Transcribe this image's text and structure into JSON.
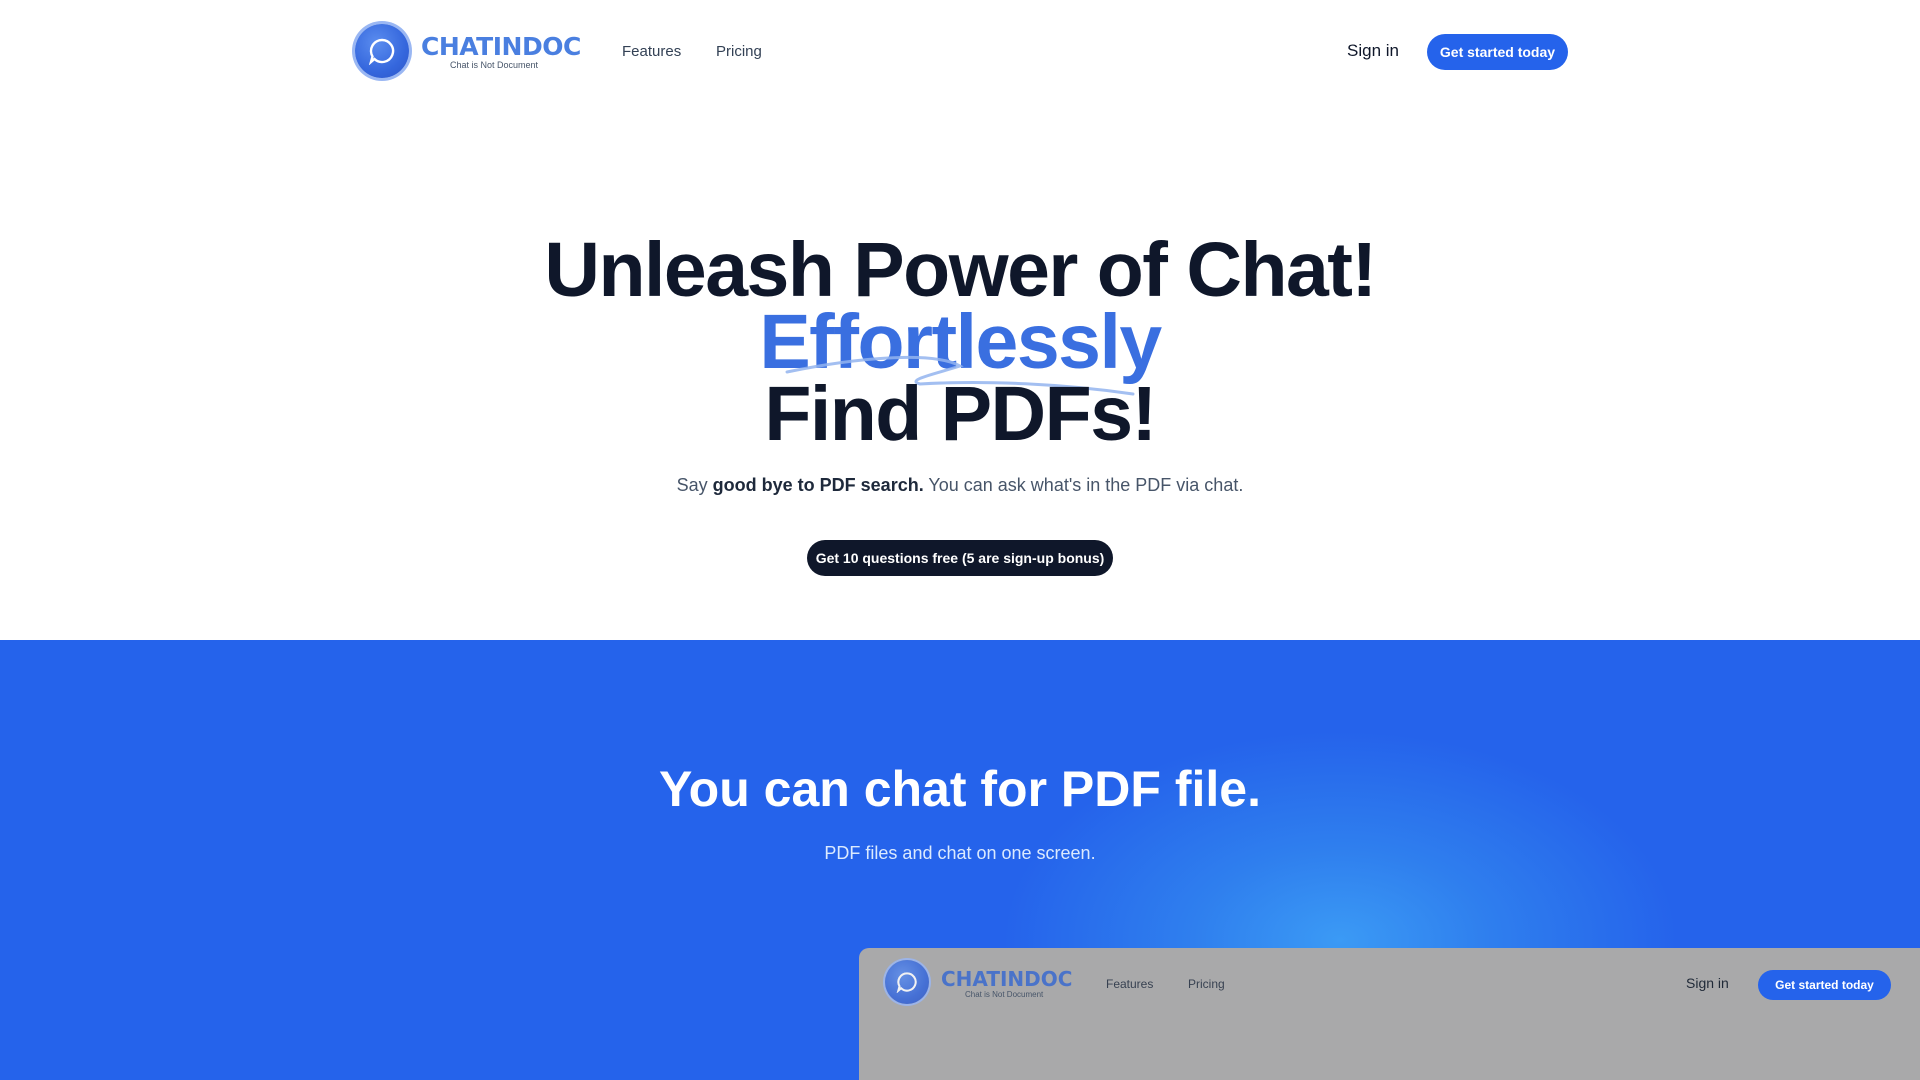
{
  "header": {
    "logo_text": "CHATINDOC",
    "logo_tagline": "Chat is Not Document",
    "nav": [
      "Features",
      "Pricing"
    ],
    "sign_in": "Sign in",
    "cta": "Get started today"
  },
  "hero": {
    "line1": "Unleash Power of Chat!",
    "line2": "Effortlessly",
    "line3": "Find PDFs!",
    "subtitle_prefix": "Say ",
    "subtitle_bold": "good bye to PDF search.",
    "subtitle_suffix": " You can ask what's in the PDF via chat.",
    "cta": "Get 10 questions free (5 are sign-up bonus)"
  },
  "feature": {
    "title": "You can chat for PDF file.",
    "subtitle": "PDF files and chat on one screen."
  },
  "preview": {
    "logo_text": "CHATINDOC",
    "logo_tagline": "Chat is Not Document",
    "nav": [
      "Features",
      "Pricing"
    ],
    "sign_in": "Sign in",
    "cta": "Get started today"
  },
  "colors": {
    "brand_blue": "#2563eb",
    "accent_text": "#3a6fe0",
    "dark": "#0f172a",
    "preview_bg": "#a9a9aa"
  },
  "icons": [
    "chat-bubble-logo-icon"
  ]
}
